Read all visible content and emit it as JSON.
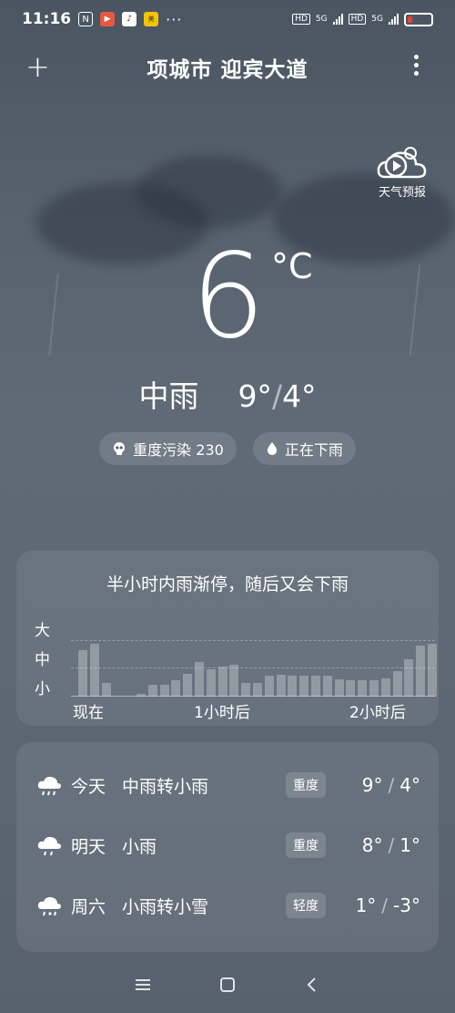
{
  "status_bar": {
    "time": "11:16",
    "net_1": "5G",
    "net_2": "5G",
    "hd_1": "HD",
    "hd_2": "HD"
  },
  "header": {
    "title": "项城市 迎宾大道",
    "add_label": "+"
  },
  "forecast_video": {
    "label": "天气预报"
  },
  "current": {
    "temperature": "6",
    "unit": "°C",
    "condition": "中雨",
    "high": "9°",
    "low": "4°"
  },
  "pills": {
    "air_quality": "重度污染 230",
    "rain_status": "正在下雨"
  },
  "rain_chart": {
    "title": "半小时内雨渐停，随后又会下雨",
    "levels": [
      "大",
      "中",
      "小"
    ],
    "x_labels": [
      "现在",
      "1小时后",
      "2小时后"
    ]
  },
  "chart_data": {
    "type": "bar",
    "title": "半小时内雨渐停，随后又会下雨",
    "y_levels": [
      "小",
      "中",
      "大"
    ],
    "ylim": [
      0,
      3
    ],
    "x_ticks": [
      "现在",
      "1小时后",
      "2小时后"
    ],
    "values": [
      2.0,
      2.3,
      0.6,
      0,
      0,
      0.1,
      0.5,
      0.5,
      0.7,
      1.0,
      1.5,
      1.2,
      1.3,
      1.4,
      0.6,
      0.6,
      0.9,
      0.95,
      0.9,
      0.9,
      0.9,
      0.9,
      0.75,
      0.7,
      0.7,
      0.7,
      0.8,
      1.1,
      1.6,
      2.2,
      2.3
    ]
  },
  "daily": [
    {
      "day": "今天",
      "condition": "中雨转小雨",
      "aqi": "重度",
      "high": "9°",
      "low": "4°",
      "icon": "rain-cloud-icon"
    },
    {
      "day": "明天",
      "condition": "小雨",
      "aqi": "重度",
      "high": "8°",
      "low": "1°",
      "icon": "rain-cloud-icon"
    },
    {
      "day": "周六",
      "condition": "小雨转小雪",
      "aqi": "轻度",
      "high": "1°",
      "low": "-3°",
      "icon": "rain-snow-cloud-icon"
    }
  ],
  "colors": {
    "background": "#5d6874",
    "battery_low": "#ff3b30"
  }
}
